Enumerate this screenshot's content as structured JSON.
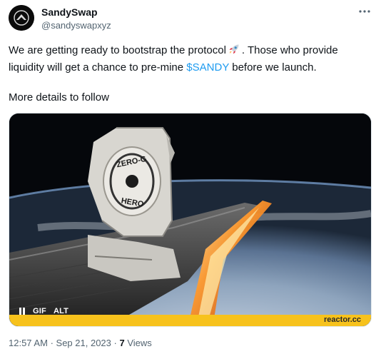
{
  "account": {
    "name": "SandySwap",
    "handle": "@sandyswapxyz",
    "avatar_icon": "rocket-emblem-icon"
  },
  "menu_icon": "more-dots-icon",
  "tweet": {
    "line1": "We are getting ready to bootstrap the protocol",
    "line1_after": ". Those who provide",
    "line2_before": "liquidity will get a chance to pre-mine ",
    "cashtag": "$SANDY",
    "line2_after": " before we launch.",
    "line3": "More details to follow",
    "emoji_icon": "rocket-emoji-icon"
  },
  "media": {
    "type": "GIF",
    "gif_label": "GIF",
    "alt_label": "ALT",
    "pause_icon": "pause-icon",
    "patch_top": "ZERO-G",
    "patch_bottom": "HERO",
    "watermark": "reactor.cc",
    "colors": {
      "brand_bar": "#f7c21c",
      "flame": "#ff7a1a"
    }
  },
  "meta": {
    "time": "12:57 AM",
    "separator": "·",
    "date": "Sep 21, 2023",
    "views_count": "7",
    "views_label": "Views"
  }
}
